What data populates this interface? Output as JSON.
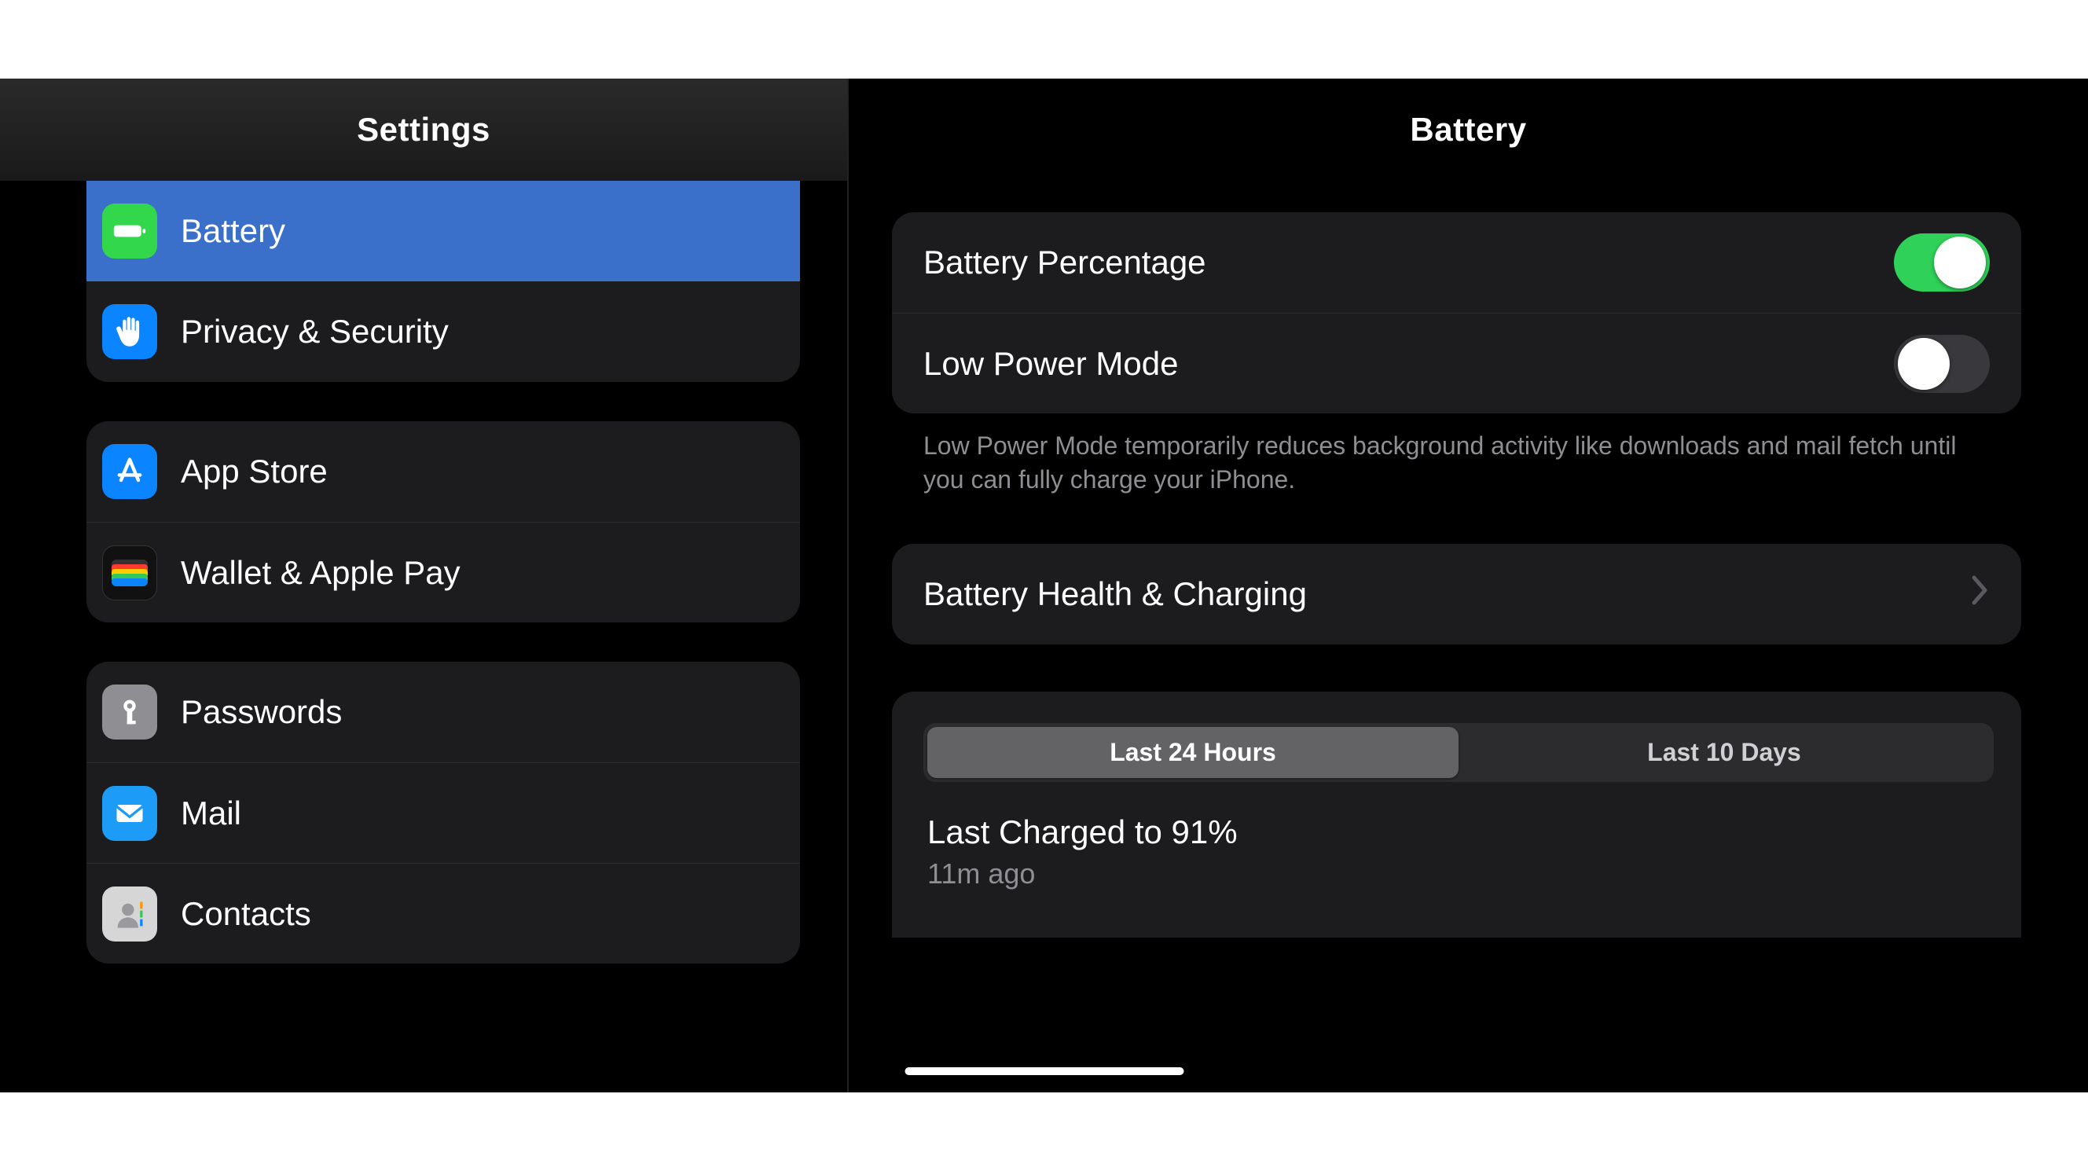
{
  "sidebar": {
    "title": "Settings",
    "groups": [
      {
        "items": [
          {
            "label": "Battery",
            "selected": true
          },
          {
            "label": "Privacy & Security",
            "selected": false
          }
        ]
      },
      {
        "items": [
          {
            "label": "App Store"
          },
          {
            "label": "Wallet & Apple Pay"
          }
        ]
      },
      {
        "items": [
          {
            "label": "Passwords"
          },
          {
            "label": "Mail"
          },
          {
            "label": "Contacts"
          }
        ]
      }
    ]
  },
  "detail": {
    "title": "Battery",
    "section1": {
      "row1": {
        "label": "Battery Percentage",
        "toggle": true
      },
      "row2": {
        "label": "Low Power Mode",
        "toggle": false
      }
    },
    "footnote": "Low Power Mode temporarily reduces background activity like downloads and mail fetch until you can fully charge your iPhone.",
    "section2": {
      "row1": {
        "label": "Battery Health & Charging"
      }
    },
    "usage": {
      "seg_a": "Last 24 Hours",
      "seg_b": "Last 10 Days",
      "active_seg": "a",
      "charge_title": "Last Charged to 91%",
      "charge_sub": "11m ago"
    }
  }
}
